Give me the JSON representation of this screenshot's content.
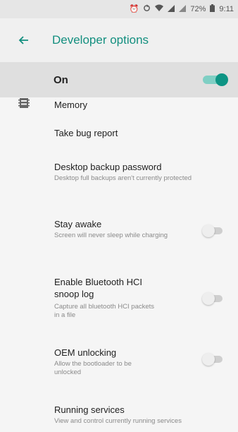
{
  "status_bar": {
    "battery": "72%",
    "time": "9:11",
    "icons": [
      "alarm-icon",
      "sync-icon",
      "wifi-icon",
      "signal-icon",
      "signal-icon",
      "battery-icon"
    ]
  },
  "app_bar": {
    "title": "Developer options",
    "back_icon": "arrow-back-icon"
  },
  "master_switch": {
    "label": "On",
    "state": true,
    "accent": "#0d9484"
  },
  "items": [
    {
      "title": "Memory",
      "icon": "memory-icon"
    },
    {
      "title": "Take bug report"
    },
    {
      "title": "Desktop backup password",
      "subtitle": "Desktop full backups aren't currently protected"
    },
    {
      "title": "Stay awake",
      "subtitle": "Screen will never sleep while charging",
      "toggle": false
    },
    {
      "title": "Enable Bluetooth HCI snoop log",
      "subtitle": "Capture all bluetooth HCI packets in a file",
      "toggle": false
    },
    {
      "title": "OEM unlocking",
      "subtitle": "Allow the bootloader to be unlocked",
      "toggle": false
    },
    {
      "title": "Running services",
      "subtitle": "View and control currently running services"
    }
  ]
}
